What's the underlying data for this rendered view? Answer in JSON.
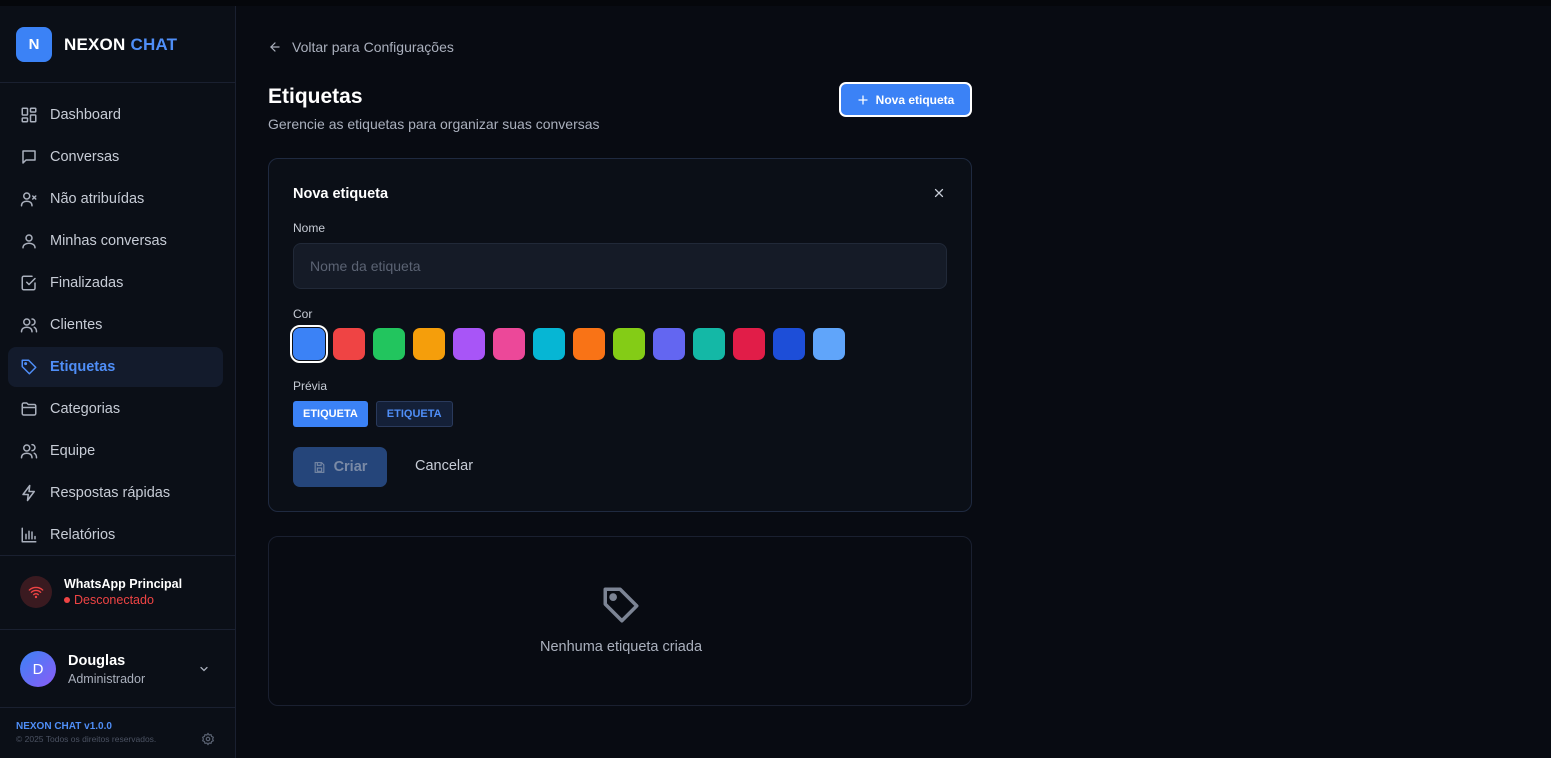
{
  "brand": {
    "logo_letter": "N",
    "name_part1": "NEXON",
    "name_part2": "CHAT"
  },
  "nav": [
    {
      "label": "Dashboard",
      "icon": "dashboard-icon"
    },
    {
      "label": "Conversas",
      "icon": "chat-icon"
    },
    {
      "label": "Não atribuídas",
      "icon": "user-x-icon"
    },
    {
      "label": "Minhas conversas",
      "icon": "user-icon"
    },
    {
      "label": "Finalizadas",
      "icon": "check-square-icon"
    },
    {
      "label": "Clientes",
      "icon": "users-icon"
    },
    {
      "label": "Etiquetas",
      "icon": "tag-icon",
      "active": true
    },
    {
      "label": "Categorias",
      "icon": "folder-icon"
    },
    {
      "label": "Equipe",
      "icon": "team-icon"
    },
    {
      "label": "Respostas rápidas",
      "icon": "zap-icon"
    },
    {
      "label": "Relatórios",
      "icon": "bar-chart-icon"
    }
  ],
  "whatsapp": {
    "name": "WhatsApp Principal",
    "status": "Desconectado",
    "status_color": "#ef4444"
  },
  "user": {
    "initial": "D",
    "name": "Douglas",
    "role": "Administrador"
  },
  "footer": {
    "version": "NEXON CHAT v1.0.0",
    "copyright": "© 2025 Todos os direitos reservados."
  },
  "page": {
    "back_label": "Voltar para Configurações",
    "title": "Etiquetas",
    "subtitle": "Gerencie as etiquetas para organizar suas conversas",
    "new_button": "Nova etiqueta"
  },
  "form": {
    "title": "Nova etiqueta",
    "name_label": "Nome",
    "name_placeholder": "Nome da etiqueta",
    "name_value": "",
    "color_label": "Cor",
    "colors": [
      "#3b82f6",
      "#ef4444",
      "#22c55e",
      "#f59e0b",
      "#a855f7",
      "#ec4899",
      "#06b6d4",
      "#f97316",
      "#84cc16",
      "#6366f1",
      "#14b8a6",
      "#e11d48",
      "#1d4ed8",
      "#60a5fa"
    ],
    "selected_color": "#3b82f6",
    "preview_label": "Prévia",
    "preview_text": "ETIQUETA",
    "create_button": "Criar",
    "cancel_button": "Cancelar"
  },
  "empty_state": {
    "text": "Nenhuma etiqueta criada"
  },
  "accent": "#3b82f6"
}
